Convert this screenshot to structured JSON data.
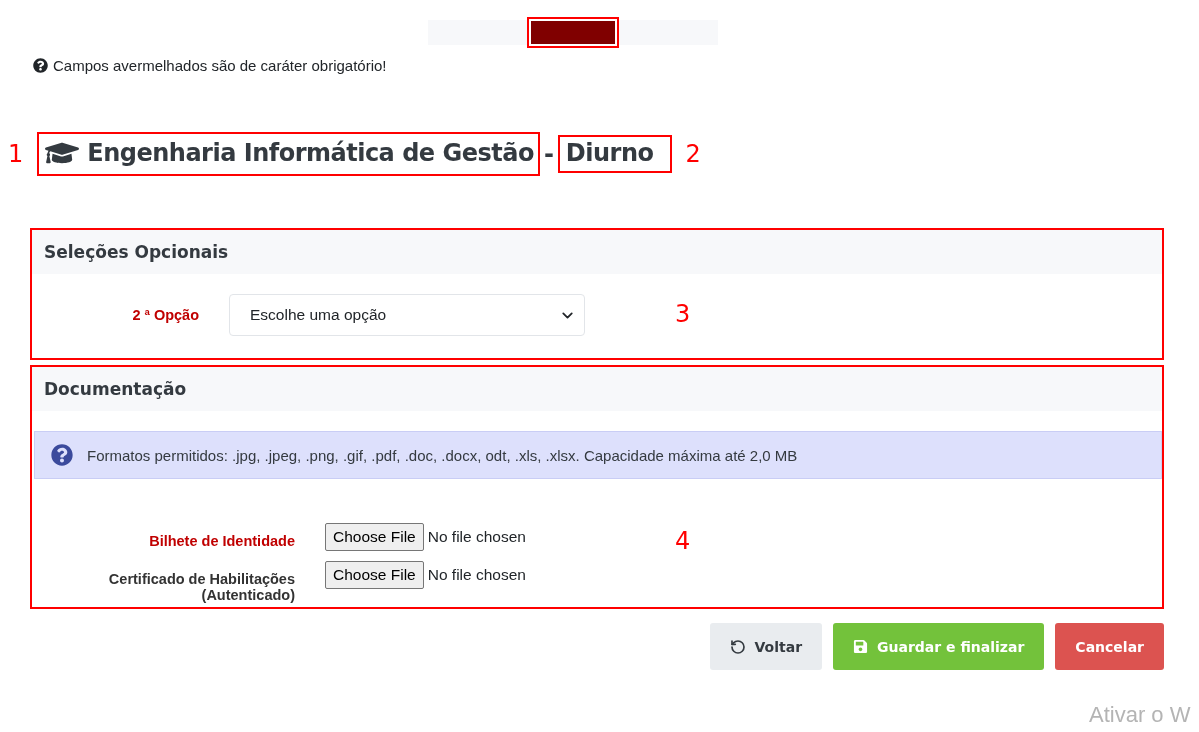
{
  "required_note": {
    "text": "Campos avermelhados são de caráter obrigatório!"
  },
  "course": {
    "name": "Engenharia Informática de Gestão",
    "separator": "-",
    "shift": "Diurno",
    "name_note": "1",
    "shift_note": "2"
  },
  "sections": [
    {
      "title": "Seleções Opcionais",
      "note": "3",
      "fields": [
        {
          "kind": "select",
          "label": "2 ª Opção",
          "required": true,
          "value": "Escolhe uma opção"
        }
      ]
    },
    {
      "title": "Documentação",
      "note": "4",
      "info": "Formatos permitidos: .jpg, .jpeg, .png, .gif, .pdf, .doc, .docx, odt, .xls, .xlsx. Capacidade máxima até 2,0 MB",
      "fields": [
        {
          "kind": "file",
          "label": "Bilhete de Identidade",
          "required": true,
          "button": "Choose File",
          "status": "No file chosen"
        },
        {
          "kind": "file",
          "label": "Certificado de Habilitações (Autenticado)",
          "required": false,
          "button": "Choose File",
          "status": "No file chosen"
        }
      ]
    }
  ],
  "buttons": [
    {
      "kind": "back",
      "label": "Voltar"
    },
    {
      "kind": "save",
      "label": "Guardar e finalizar"
    },
    {
      "kind": "cancel",
      "label": "Cancelar"
    }
  ],
  "watermark": "Ativar o W"
}
